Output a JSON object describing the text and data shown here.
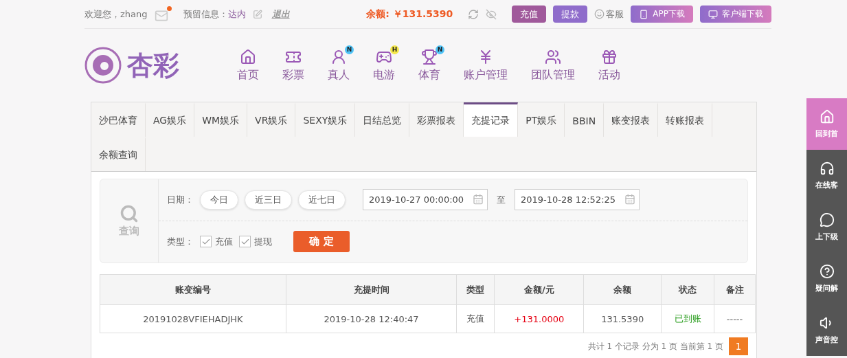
{
  "top_bar": {
    "welcome": "欢迎您，zhang",
    "mail_unread": true,
    "reserved_label": "预留信息：",
    "reserved_value": "达内",
    "logout": "退出",
    "balance_label": "余额:",
    "balance": "￥131.5390",
    "balance_hidden": false,
    "buttons": [
      {
        "label": "充值",
        "kind": "deposit"
      },
      {
        "label": "提款",
        "kind": "withdraw"
      }
    ],
    "service": "客服",
    "downloads": [
      {
        "label": "APP下载",
        "kind": "phone"
      },
      {
        "label": "客户端下载",
        "kind": "desktop"
      }
    ]
  },
  "logo": {
    "text": "杏彩"
  },
  "nav": [
    {
      "label": "首页"
    },
    {
      "label": "彩票"
    },
    {
      "label": "真人",
      "badge": "N",
      "color": "#4fc3f7"
    },
    {
      "label": "电游",
      "badge": "H",
      "color": "#f5e84a"
    },
    {
      "label": "体育",
      "badge": "N",
      "color": "#4fc3f7"
    },
    {
      "label": "账户管理"
    },
    {
      "label": "团队管理"
    },
    {
      "label": "活动"
    }
  ],
  "tabs": [
    {
      "label": "沙巴体育",
      "selected": false
    },
    {
      "label": "AG娱乐",
      "selected": false
    },
    {
      "label": "WM娱乐",
      "selected": false
    },
    {
      "label": "VR娱乐",
      "selected": false
    },
    {
      "label": "SEXY娱乐",
      "selected": false
    },
    {
      "label": "日结总览",
      "selected": false
    },
    {
      "label": "彩票报表",
      "selected": false
    },
    {
      "label": "充提记录",
      "selected": true
    },
    {
      "label": "PT娱乐",
      "selected": false
    },
    {
      "label": "BBIN",
      "selected": false
    },
    {
      "label": "账变报表",
      "selected": false
    },
    {
      "label": "转账报表",
      "selected": false
    },
    {
      "label": "余额查询",
      "selected": false
    }
  ],
  "search": {
    "label": "查询",
    "date_label": "日期：",
    "ranges": [
      "今日",
      "近三日",
      "近七日"
    ],
    "date_from": "2019-10-27 00:00:00",
    "to_label": "至",
    "date_to": "2019-10-28 12:52:25",
    "type_label": "类型：",
    "types": [
      {
        "label": "充值",
        "checked": true
      },
      {
        "label": "提现",
        "checked": true
      }
    ],
    "confirm": "确 定"
  },
  "table": {
    "columns": [
      "账变编号",
      "充提时间",
      "类型",
      "金额/元",
      "余额",
      "状态",
      "备注"
    ],
    "rows": [
      {
        "cells": [
          "20191028VFIEHADJHK",
          "2019-10-28 12:40:47",
          "充值",
          "+131.0000",
          "131.5390",
          "已到账",
          "-----"
        ]
      }
    ]
  },
  "pagination": {
    "summary": "共计 1 个记录 分为 1 页 当前第 1 页",
    "pages": [
      {
        "label": "1",
        "selected": true
      }
    ]
  },
  "side_panel": [
    {
      "label": "回到首",
      "selected": true
    },
    {
      "label": "在线客",
      "selected": false
    },
    {
      "label": "上下级",
      "selected": false
    },
    {
      "label": "疑问解",
      "selected": false
    },
    {
      "label": "声音控",
      "selected": false
    }
  ]
}
